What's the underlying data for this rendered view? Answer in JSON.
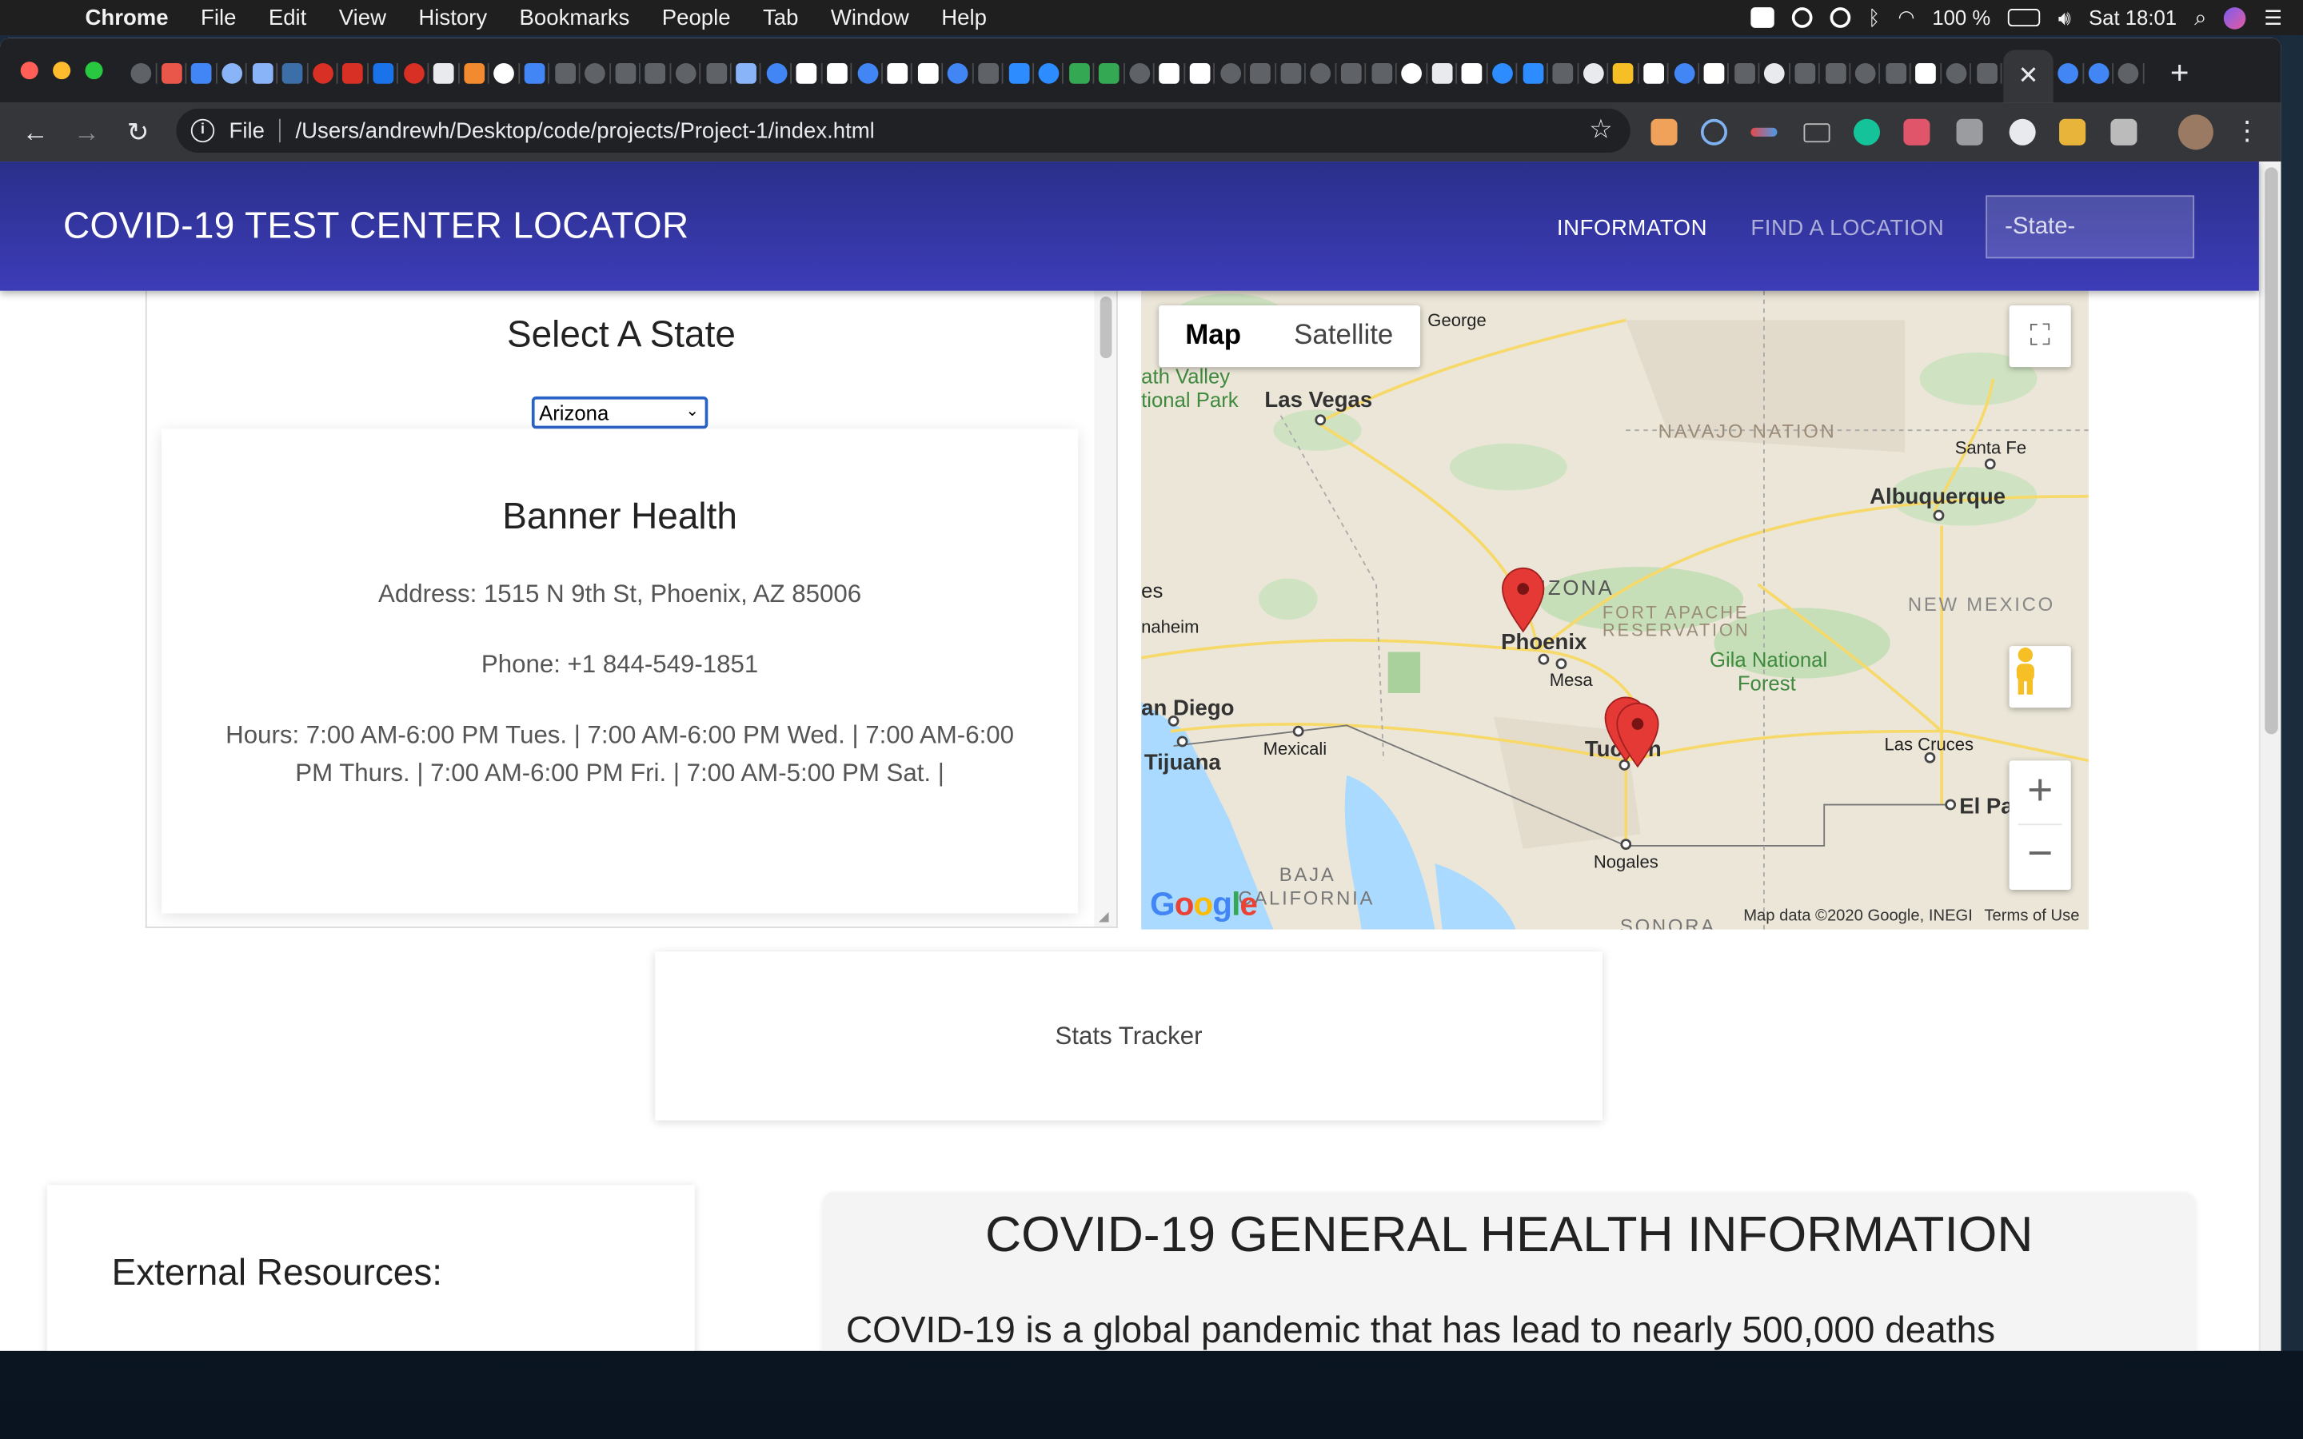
{
  "menubar": {
    "app": "Chrome",
    "items": [
      "File",
      "Edit",
      "View",
      "History",
      "Bookmarks",
      "People",
      "Tab",
      "Window",
      "Help"
    ],
    "battery": "100 %",
    "clock": "Sat 18:01"
  },
  "browser": {
    "scheme": "File",
    "url": "/Users/andrewh/Desktop/code/projects/Project-1/index.html",
    "tab_close": "✕",
    "new_tab": "+"
  },
  "page": {
    "brand": "COVID-19 TEST CENTER LOCATOR",
    "nav": {
      "info": "INFORMATON",
      "find": "FIND A LOCATION",
      "state_placeholder": "-State-"
    },
    "select_title": "Select A State",
    "selected_state": "Arizona",
    "location": {
      "name": "Banner Health",
      "address": "Address: 1515 N 9th St, Phoenix, AZ 85006",
      "phone": "Phone: +1 844-549-1851",
      "hours": "Hours: 7:00 AM-6:00 PM Tues. | 7:00 AM-6:00 PM Wed. | 7:00 AM-6:00 PM Thurs. | 7:00 AM-6:00 PM Fri. | 7:00 AM-5:00 PM Sat. |"
    },
    "map": {
      "type_map": "Map",
      "type_satellite": "Satellite",
      "zoom_in": "+",
      "zoom_out": "−",
      "attribution": "Map data ©2020 Google, INEGI",
      "terms": "Terms of Use",
      "labels": {
        "las_vegas": "Las Vegas",
        "death_valley_1": "ath Valley",
        "death_valley_2": "tional Park",
        "navajo": "NAVAJO NATION",
        "santa_fe": "Santa Fe",
        "albuquerque": "Albuquerque",
        "arizona": "RIZONA",
        "fort_apache_1": "FORT APACHE",
        "fort_apache_2": "RESERVATION",
        "new_mexico": "NEW MEXICO",
        "phoenix": "Phoenix",
        "mesa": "Mesa",
        "gila_1": "Gila National",
        "gila_2": "Forest",
        "es": "es",
        "anaheim": "naheim",
        "san_diego": "an Diego",
        "tijuana": "Tijuana",
        "mexicali": "Mexicali",
        "tucson": "Tucson",
        "las_cruces": "Las Cruces",
        "el_paso": "El Pa",
        "nogales": "Nogales",
        "baja_1": "BAJA",
        "baja_2": "CALIFORNIA",
        "george": "George",
        "sonora": "SONORA"
      }
    },
    "stats_label": "Stats Tracker",
    "external_title": "External Resources:",
    "info_title": "COVID-19 GENERAL HEALTH INFORMATION",
    "info_body": "COVID-19 is a global pandemic that has lead to nearly 500,000 deaths"
  }
}
